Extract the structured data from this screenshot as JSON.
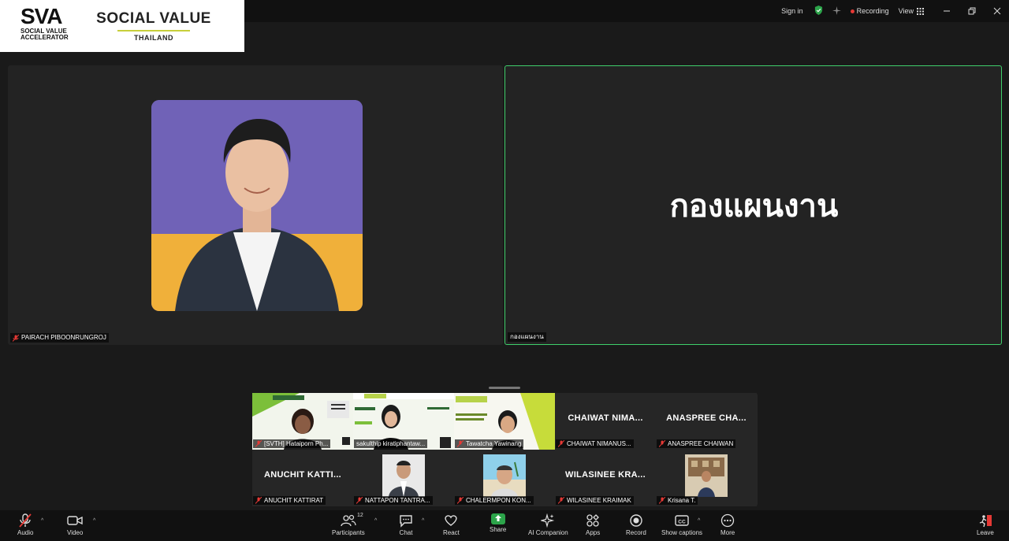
{
  "logo": {
    "sva_big": "SVA",
    "sva_line1": "SOCIAL VALUE",
    "sva_line2": "ACCELERATOR",
    "svt_big": "SOCIAL VALUE",
    "svt_small": "THAILAND"
  },
  "topbar": {
    "sign_in": "Sign in",
    "recording": "Recording",
    "view": "View"
  },
  "main": {
    "left_name": "PAIRACH PIBOONRUNGROJ",
    "right_big": "กองแผนงาน",
    "right_name": "กองแผนงาน"
  },
  "gallery": {
    "tiles": [
      {
        "tag": "[SVTH] Hataiporn Ph..."
      },
      {
        "tag": "sakulthip kiratiphantaw..."
      },
      {
        "tag": "Tawatcha Yawinang"
      },
      {
        "big": "CHAIWAT NIMA...",
        "tag": "CHAIWAT NIMANUS..."
      },
      {
        "big": "ANASPREE CHA...",
        "tag": "ANASPREE CHAIWAN"
      },
      {
        "big": "ANUCHIT KATTI...",
        "tag": "ANUCHIT KATTIRAT"
      },
      {
        "tag": "NATTAPON TANTRA..."
      },
      {
        "tag": "CHALERMPON KON..."
      },
      {
        "big": "WILASINEE KRA...",
        "tag": "WILASINEE KRAIMAK"
      },
      {
        "tag": "Krisana T."
      }
    ]
  },
  "toolbar": {
    "audio": "Audio",
    "video": "Video",
    "participants": "Participants",
    "participants_count": "12",
    "chat": "Chat",
    "react": "React",
    "share": "Share",
    "ai_companion": "AI Companion",
    "apps": "Apps",
    "record": "Record",
    "show_captions": "Show captions",
    "more": "More",
    "leave": "Leave"
  },
  "colors": {
    "active_speaker_border": "#3fcf6b",
    "share_green": "#2ca44a",
    "recording_red": "#e53935",
    "mic_muted_red": "#e53935"
  }
}
